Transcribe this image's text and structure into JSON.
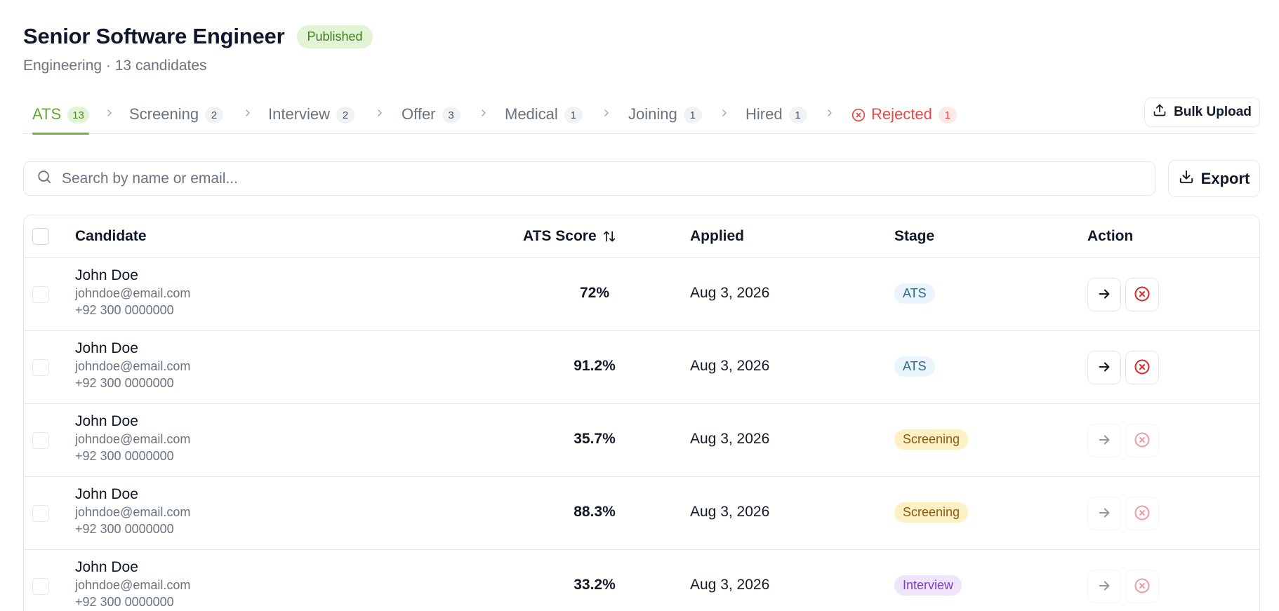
{
  "job": {
    "title": "Senior Software Engineer",
    "status": "Published",
    "subtitle": "Engineering · 13 candidates"
  },
  "tabs": [
    {
      "label": "ATS",
      "count": "13",
      "active": true
    },
    {
      "label": "Screening",
      "count": "2"
    },
    {
      "label": "Interview",
      "count": "2"
    },
    {
      "label": "Offer",
      "count": "3"
    },
    {
      "label": "Medical",
      "count": "1"
    },
    {
      "label": "Joining",
      "count": "1"
    },
    {
      "label": "Hired",
      "count": "1"
    },
    {
      "label": "Rejected",
      "count": "1",
      "icon": "x-circle-icon"
    }
  ],
  "toolbar": {
    "bulk_upload_label": "Bulk Upload",
    "export_label": "Export",
    "search_placeholder": "Search by name or email...",
    "search_value": ""
  },
  "table": {
    "headers": {
      "candidate": "Candidate",
      "ats_score": "ATS Score",
      "applied": "Applied",
      "stage": "Stage",
      "action": "Action"
    },
    "rows": [
      {
        "name": "John Doe",
        "email": "johndoe@email.com",
        "phone": "+92 300 0000000",
        "score": "72%",
        "applied": "Aug 3, 2026",
        "stage": "ATS",
        "actions_enabled": true
      },
      {
        "name": "John Doe",
        "email": "johndoe@email.com",
        "phone": "+92 300 0000000",
        "score": "91.2%",
        "applied": "Aug 3, 2026",
        "stage": "ATS",
        "actions_enabled": true
      },
      {
        "name": "John Doe",
        "email": "johndoe@email.com",
        "phone": "+92 300 0000000",
        "score": "35.7%",
        "applied": "Aug 3, 2026",
        "stage": "Screening",
        "actions_enabled": false
      },
      {
        "name": "John Doe",
        "email": "johndoe@email.com",
        "phone": "+92 300 0000000",
        "score": "88.3%",
        "applied": "Aug 3, 2026",
        "stage": "Screening",
        "actions_enabled": false
      },
      {
        "name": "John Doe",
        "email": "johndoe@email.com",
        "phone": "+92 300 0000000",
        "score": "33.2%",
        "applied": "Aug 3, 2026",
        "stage": "Interview",
        "actions_enabled": false
      }
    ]
  },
  "icons": {
    "search": "search-icon",
    "upload": "upload-icon",
    "download": "download-icon",
    "sort": "sort-icon",
    "next": "arrow-right-icon",
    "reject": "x-circle-icon",
    "separator": "chevron-right-icon"
  },
  "colors": {
    "accent": "#6fb23b",
    "published_bg": "#e3f3d6",
    "reject": "#ef4444",
    "reject_action": "#dc2626"
  }
}
